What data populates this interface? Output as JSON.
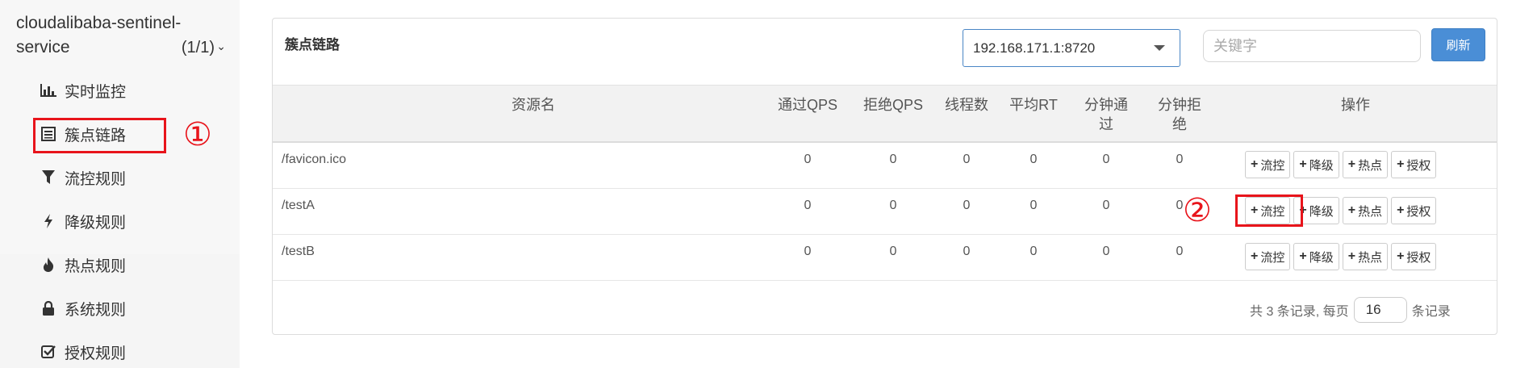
{
  "sidebar": {
    "app_name": "cloudalibaba-sentinel-service",
    "app_count": "(1/1)",
    "items": [
      {
        "label": "实时监控",
        "icon": "bar-chart-icon"
      },
      {
        "label": "簇点链路",
        "icon": "list-icon"
      },
      {
        "label": "流控规则",
        "icon": "filter-icon"
      },
      {
        "label": "降级规则",
        "icon": "lightning-icon"
      },
      {
        "label": "热点规则",
        "icon": "fire-icon"
      },
      {
        "label": "系统规则",
        "icon": "lock-icon"
      },
      {
        "label": "授权规则",
        "icon": "check-square-icon"
      }
    ]
  },
  "annotations": {
    "one": "①",
    "two": "②",
    "color": "#e8141b"
  },
  "panel": {
    "title": "簇点链路",
    "machine": "192.168.171.1:8720",
    "keyword_placeholder": "关键字",
    "refresh_label": "刷新"
  },
  "table": {
    "headers": {
      "resource": "资源名",
      "pass_qps": "通过QPS",
      "block_qps": "拒绝QPS",
      "threads": "线程数",
      "avg_rt": "平均RT",
      "minute_pass_1": "分钟通",
      "minute_pass_2": "过",
      "minute_block_1": "分钟拒",
      "minute_block_2": "绝",
      "actions": "操作"
    },
    "rows": [
      {
        "resource": "/favicon.ico",
        "pass_qps": "0",
        "block_qps": "0",
        "threads": "0",
        "avg_rt": "0",
        "minute_pass": "0",
        "minute_block": "0"
      },
      {
        "resource": "/testA",
        "pass_qps": "0",
        "block_qps": "0",
        "threads": "0",
        "avg_rt": "0",
        "minute_pass": "0",
        "minute_block": "0"
      },
      {
        "resource": "/testB",
        "pass_qps": "0",
        "block_qps": "0",
        "threads": "0",
        "avg_rt": "0",
        "minute_pass": "0",
        "minute_block": "0"
      }
    ],
    "actions": {
      "flow": "流控",
      "degrade": "降级",
      "hot": "热点",
      "auth": "授权"
    }
  },
  "pager": {
    "summary": "共 3 条记录, 每页",
    "page_size": "16",
    "suffix": "条记录"
  }
}
